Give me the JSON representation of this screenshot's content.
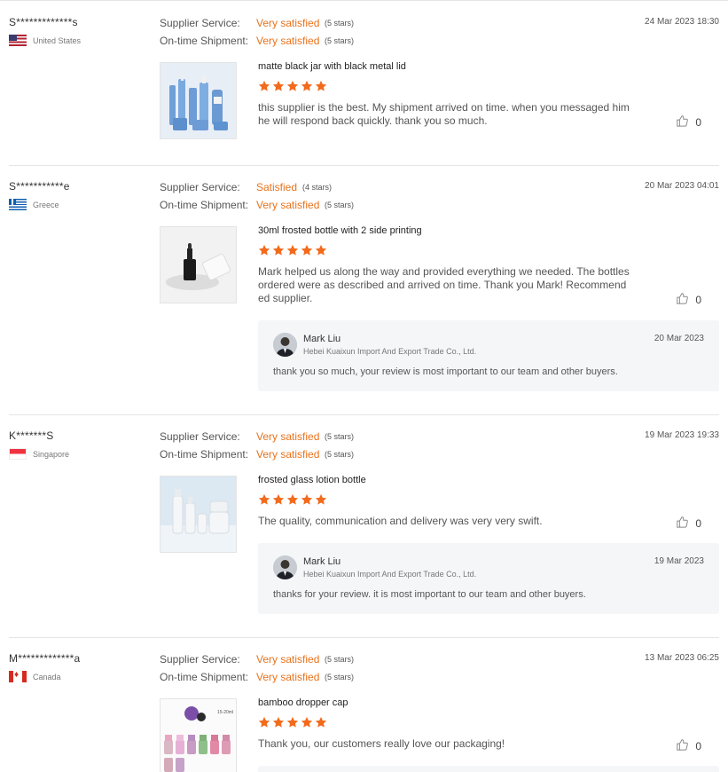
{
  "labels": {
    "supplier_service": "Supplier Service:",
    "ontime_shipment": "On-time Shipment:"
  },
  "star_color": "#f26b1d",
  "reviews": [
    {
      "user": "S*************s",
      "country": "United States",
      "flag": "us-flag",
      "date": "24 Mar 2023 18:30",
      "supplier_service": {
        "value": "Very satisfied",
        "stars_text": "(5 stars)",
        "stars": 5
      },
      "shipment": {
        "value": "Very satisfied",
        "stars_text": "(5 stars)",
        "stars": 5
      },
      "product": "matte black jar with black metal lid",
      "rating": 5,
      "text": "this supplier is the best. My shipment arrived on time. when you messaged him he will respond back quickly. thank you so much.",
      "likes": "0"
    },
    {
      "user": "S***********e",
      "country": "Greece",
      "flag": "greece-flag",
      "date": "20 Mar 2023 04:01",
      "supplier_service": {
        "value": "Satisfied",
        "stars_text": "(4 stars)",
        "stars": 4
      },
      "shipment": {
        "value": "Very satisfied",
        "stars_text": "(5 stars)",
        "stars": 5
      },
      "product": "30ml frosted bottle with 2 side printing",
      "rating": 5,
      "text": "Mark helped us along the way and provided everything we needed. The bottles ordered were as described and arrived on time. Thank you Mark! Recommended supplier.",
      "likes": "0",
      "reply": {
        "name": "Mark Liu",
        "company": "Hebei Kuaixun Import And Export Trade Co., Ltd.",
        "date": "20 Mar 2023",
        "text": "thank you so much, your review is most important to our team and other buyers."
      }
    },
    {
      "user": "K*******S",
      "country": "Singapore",
      "flag": "singapore-flag",
      "date": "19 Mar 2023 19:33",
      "supplier_service": {
        "value": "Very satisfied",
        "stars_text": "(5 stars)",
        "stars": 5
      },
      "shipment": {
        "value": "Very satisfied",
        "stars_text": "(5 stars)",
        "stars": 5
      },
      "product": "frosted glass lotion bottle",
      "rating": 5,
      "text": "The quality, communication and delivery was very very swift.",
      "likes": "0",
      "reply": {
        "name": "Mark Liu",
        "company": "Hebei Kuaixun Import And Export Trade Co., Ltd.",
        "date": "19 Mar 2023",
        "text": "thanks for your review. it is most important to our team and other buyers."
      }
    },
    {
      "user": "M*************a",
      "country": "Canada",
      "flag": "canada-flag",
      "date": "13 Mar 2023 06:25",
      "supplier_service": {
        "value": "Very satisfied",
        "stars_text": "(5 stars)",
        "stars": 5
      },
      "shipment": {
        "value": "Very satisfied",
        "stars_text": "(5 stars)",
        "stars": 5
      },
      "product": "bamboo dropper cap",
      "rating": 5,
      "text": "Thank you, our customers really love our packaging!",
      "likes": "0",
      "thumb_label": "15-20ml"
    }
  ]
}
